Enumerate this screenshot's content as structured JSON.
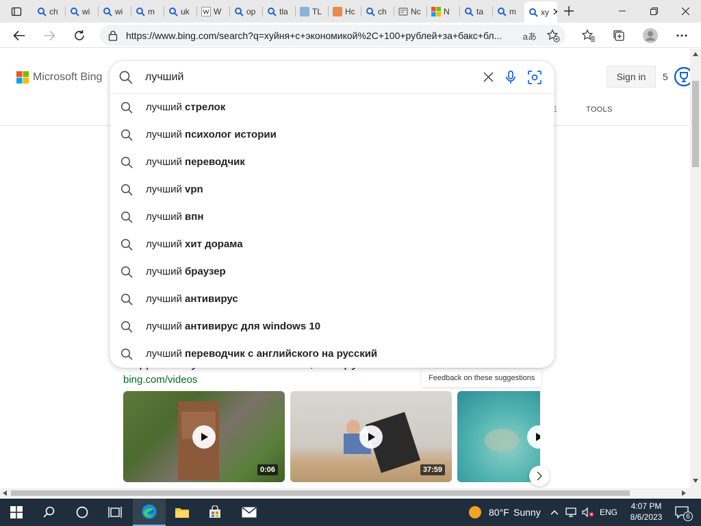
{
  "browser": {
    "tabs": [
      {
        "label": "ch",
        "icon": "bing-search-icon"
      },
      {
        "label": "wi",
        "icon": "bing-search-icon"
      },
      {
        "label": "wi",
        "icon": "bing-search-icon"
      },
      {
        "label": "m",
        "icon": "bing-search-icon"
      },
      {
        "label": "uk",
        "icon": "bing-search-icon"
      },
      {
        "label": "W",
        "icon": "wikipedia-icon"
      },
      {
        "label": "op",
        "icon": "bing-search-icon"
      },
      {
        "label": "tla",
        "icon": "bing-search-icon"
      },
      {
        "label": "TL",
        "icon": "tl-icon"
      },
      {
        "label": "Hc",
        "icon": "mc-icon"
      },
      {
        "label": "ch",
        "icon": "bing-search-icon"
      },
      {
        "label": "Nc",
        "icon": "page-icon"
      },
      {
        "label": "N",
        "icon": "microsoft-icon"
      },
      {
        "label": "ta",
        "icon": "bing-search-icon"
      },
      {
        "label": "m",
        "icon": "bing-search-icon"
      },
      {
        "label": "xy",
        "icon": "bing-search-icon"
      }
    ],
    "url": "https://www.bing.com/search?q=хуйня+с+экономикой%2C+100+рублей+за+бакс+бл...",
    "read_aloud": "aあ"
  },
  "bing": {
    "logo_label": "Microsoft Bing",
    "sign_in": "Sign in",
    "points": "5",
    "tools_tab": "TOOLS",
    "tabs_hint": "E",
    "query": "лучший",
    "suggestions": [
      {
        "prefix": "лучший",
        "bold": "стрелок"
      },
      {
        "prefix": "лучший",
        "bold": "психолог истории"
      },
      {
        "prefix": "лучший",
        "bold": "переводчик"
      },
      {
        "prefix": "лучший",
        "bold": "vpn"
      },
      {
        "prefix": "лучший",
        "bold": "впн"
      },
      {
        "prefix": "лучший",
        "bold": "хит дорама"
      },
      {
        "prefix": "лучший",
        "bold": "браузер"
      },
      {
        "prefix": "лучший",
        "bold": "антивирус"
      },
      {
        "prefix": "лучший",
        "bold": "антивирус для windows 10"
      },
      {
        "prefix": "лучший",
        "bold": "переводчик с английского на русский"
      }
    ],
    "feedback": "Feedback on these suggestions",
    "videos_title": "Видео от хуйня с экономикой, 100 рублей за б",
    "videos_source": "bing.com/videos",
    "videos": [
      {
        "duration": "0:06"
      },
      {
        "duration": "37:59"
      },
      {
        "duration": ""
      }
    ]
  },
  "taskbar": {
    "weather_temp": "80°F",
    "weather_desc": "Sunny",
    "language": "ENG",
    "time": "4:07 PM",
    "date": "8/6/2023",
    "notifications": "6"
  }
}
